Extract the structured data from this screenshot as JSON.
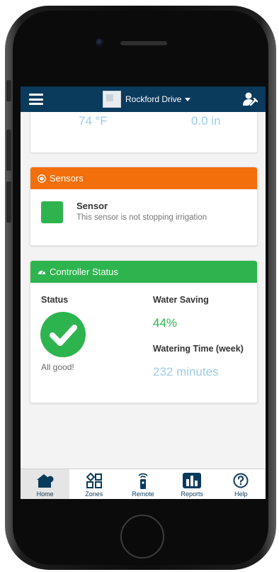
{
  "header": {
    "site_name": "Rockford Drive"
  },
  "weather": {
    "temperature": "74 °F",
    "rainfall": "0.0 in"
  },
  "sensors": {
    "title": "Sensors",
    "sensor_name": "Sensor",
    "sensor_status_text": "This sensor is not stopping irrigation",
    "status_color": "#2eb44e"
  },
  "controller_status": {
    "title": "Controller Status",
    "status_label": "Status",
    "status_text": "All good!",
    "water_saving_label": "Water Saving",
    "water_saving_value": "44%",
    "watering_time_label": "Watering Time (week)",
    "watering_time_value": "232 minutes"
  },
  "bottom_nav": {
    "items": [
      {
        "label": "Home",
        "icon": "home-icon",
        "active": true
      },
      {
        "label": "Zones",
        "icon": "zones-icon",
        "active": false
      },
      {
        "label": "Remote",
        "icon": "remote-icon",
        "active": false
      },
      {
        "label": "Reports",
        "icon": "reports-icon",
        "active": false
      },
      {
        "label": "Help",
        "icon": "help-icon",
        "active": false
      }
    ]
  },
  "colors": {
    "navbar": "#0a3a5c",
    "sensors_header": "#f26f0c",
    "controller_header": "#2eb44e",
    "muted_value": "#9ecbe8"
  }
}
